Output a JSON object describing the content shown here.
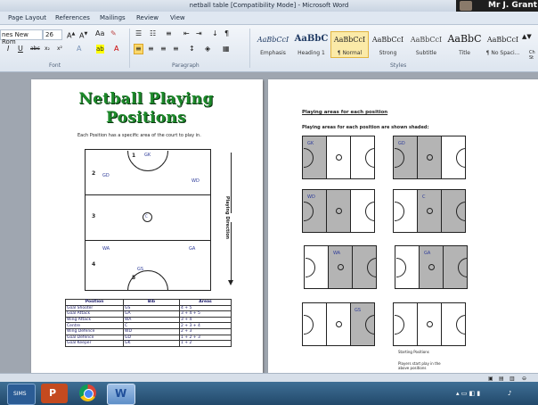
{
  "window": {
    "title": "netball table [Compatibility Mode] - Microsoft Word",
    "user": "Mr J. Grant"
  },
  "tabs": [
    "Page Layout",
    "References",
    "Mailings",
    "Review",
    "View"
  ],
  "ribbon": {
    "font_name": "nes New Rom",
    "font_size": "26",
    "groups": {
      "font": "Font",
      "paragraph": "Paragraph",
      "styles": "Styles"
    },
    "styles": [
      {
        "sample": "AaBbCcI",
        "name": "Emphasis"
      },
      {
        "sample": "AaBbC",
        "name": "Heading 1"
      },
      {
        "sample": "AaBbCcI",
        "name": "¶ Normal"
      },
      {
        "sample": "AaBbCcI",
        "name": "Strong"
      },
      {
        "sample": "AaBbCcI",
        "name": "Subtitle"
      },
      {
        "sample": "AaBbC",
        "name": "Title"
      },
      {
        "sample": "AaBbCcI",
        "name": "¶ No Spaci..."
      }
    ],
    "change_styles": "Ch St"
  },
  "page1": {
    "title_line1": "Netball Playing",
    "title_line2": "Positions",
    "subtitle": "Each Position has a specific area of the court to play in.",
    "court_labels": {
      "zone1": "1",
      "zone2": "2",
      "zone3": "3",
      "zone4": "4",
      "zone5": "5",
      "gk": "GK",
      "gd": "GD",
      "wd": "WD",
      "c": "C",
      "wa": "WA",
      "ga": "GA",
      "gs": "GS"
    },
    "direction_label": "Playing Direction",
    "table": {
      "headers": [
        "Position",
        "Bib",
        "Areas"
      ],
      "rows": [
        [
          "Goal Shooter",
          "GS",
          "4 + 5"
        ],
        [
          "Goal Attack",
          "GA",
          "3 + 4 + 5"
        ],
        [
          "Wing Attack",
          "WA",
          "3 + 4"
        ],
        [
          "Centre",
          "C",
          "2 + 3 + 4"
        ],
        [
          "Wing Defence",
          "WD",
          "2 + 3"
        ],
        [
          "Goal Defence",
          "GD",
          "1 + 2 + 3"
        ],
        [
          "Goal Keeper",
          "GK",
          "1 + 2"
        ]
      ]
    }
  },
  "page2": {
    "heading": "Playing areas for each position",
    "intro": "Playing areas for each position are shown shaded:",
    "courts": [
      {
        "label": "GK",
        "shaded": [
          1,
          0,
          0
        ]
      },
      {
        "label": "GD",
        "shaded": [
          1,
          1,
          0
        ]
      },
      {
        "label": "WD",
        "shaded": [
          1,
          1,
          0
        ]
      },
      {
        "label": "C",
        "shaded": [
          0,
          1,
          1
        ]
      },
      {
        "label": "WA",
        "shaded": [
          0,
          1,
          1
        ]
      },
      {
        "label": "GA",
        "shaded": [
          0,
          1,
          1
        ]
      },
      {
        "label": "GS",
        "shaded": [
          0,
          0,
          1
        ]
      },
      {
        "label": "",
        "shaded": [
          0,
          0,
          0
        ]
      }
    ],
    "starting_positions": "Starting Positions",
    "footer_note": "Players start play in the above positions"
  },
  "taskbar": {
    "sims": "SIMS"
  },
  "colors": {
    "title_green": "#1c8a2a",
    "shade": "#b4b4b4",
    "taskbar": "#2e5b80"
  }
}
